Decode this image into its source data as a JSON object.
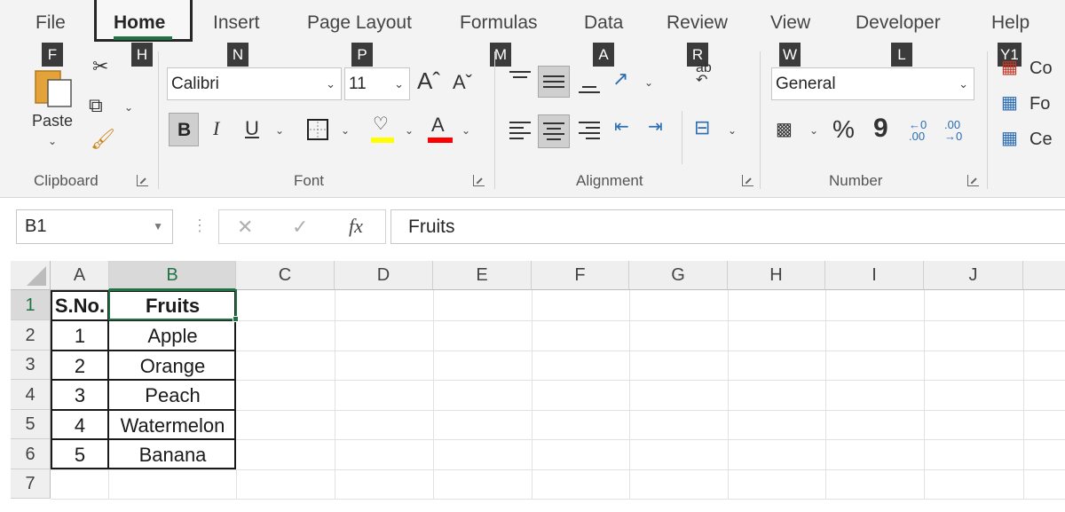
{
  "tabs": [
    "File",
    "Home",
    "Insert",
    "Page Layout",
    "Formulas",
    "Data",
    "Review",
    "View",
    "Developer",
    "Help"
  ],
  "keytips": [
    "F",
    "H",
    "N",
    "P",
    "M",
    "A",
    "R",
    "W",
    "L",
    "Y1"
  ],
  "clipboard": {
    "paste_label": "Paste",
    "group_label": "Clipboard"
  },
  "font": {
    "name": "Calibri",
    "size": "11",
    "group_label": "Font",
    "bold": "B",
    "italic": "I",
    "underline": "U",
    "fill_color": "#ffff00",
    "font_color": "#ff0000"
  },
  "alignment": {
    "group_label": "Alignment"
  },
  "number": {
    "format": "General",
    "group_label": "Number",
    "percent": "%",
    "comma": "9"
  },
  "styles": {
    "conditional": "Co",
    "format_table": "Fo",
    "cell_styles": "Ce"
  },
  "formula_bar": {
    "name_box": "B1",
    "fx": "fx",
    "content": "Fruits"
  },
  "sheet": {
    "columns": [
      "A",
      "B",
      "C",
      "D",
      "E",
      "F",
      "G",
      "H",
      "I",
      "J"
    ],
    "rows": [
      "1",
      "2",
      "3",
      "4",
      "5",
      "6",
      "7"
    ],
    "cells": [
      [
        "S.No.",
        "Fruits"
      ],
      [
        "1",
        "Apple"
      ],
      [
        "2",
        "Orange"
      ],
      [
        "3",
        "Peach"
      ],
      [
        "4",
        "Watermelon"
      ],
      [
        "5",
        "Banana"
      ]
    ],
    "selected_cell": "B1",
    "accent": "#217346"
  }
}
